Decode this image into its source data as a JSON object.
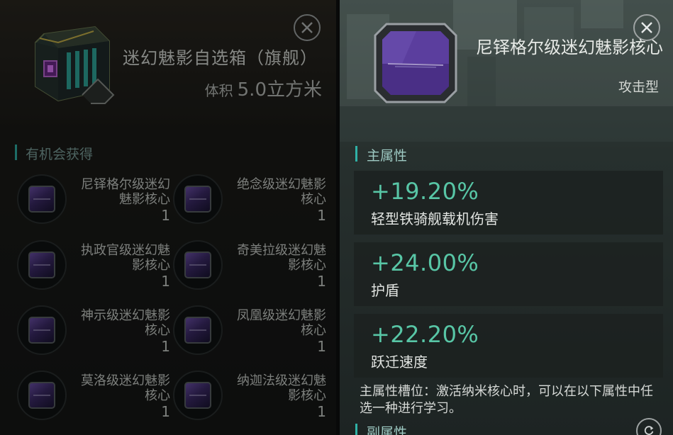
{
  "left_panel": {
    "title": "迷幻魅影自选箱（旗舰）",
    "volume_label": "体积",
    "volume_value": "5.0立方米",
    "section_label": "有机会获得",
    "rewards": [
      {
        "name": "尼铎格尔级迷幻魅影核心",
        "count": "1"
      },
      {
        "name": "绝念级迷幻魅影核心",
        "count": "1"
      },
      {
        "name": "执政官级迷幻魅影核心",
        "count": "1"
      },
      {
        "name": "奇美拉级迷幻魅影核心",
        "count": "1"
      },
      {
        "name": "神示级迷幻魅影核心",
        "count": "1"
      },
      {
        "name": "凤凰级迷幻魅影核心",
        "count": "1"
      },
      {
        "name": "莫洛级迷幻魅影核心",
        "count": "1"
      },
      {
        "name": "纳迦法级迷幻魅影核心",
        "count": "1"
      }
    ]
  },
  "right_panel": {
    "title": "尼铎格尔级迷幻魅影核心",
    "subtitle": "攻击型",
    "main_section_label": "主属性",
    "stats": [
      {
        "value": "+19.20%",
        "name": "轻型铁骑舰载机伤害"
      },
      {
        "value": "+24.00%",
        "name": "护盾"
      },
      {
        "value": "+22.20%",
        "name": "跃迁速度"
      }
    ],
    "note": "主属性槽位：激活纳米核心时，可以在以下属性中任选一种进行学习。",
    "sub_section_label": "副属性"
  },
  "colors": {
    "accent_teal": "#2fb1a6",
    "stat_green": "#58c6a6",
    "core_purple": "#5a3d96"
  },
  "icons": [
    "close-icon",
    "refresh-icon",
    "crate-icon",
    "core-gem-icon"
  ]
}
